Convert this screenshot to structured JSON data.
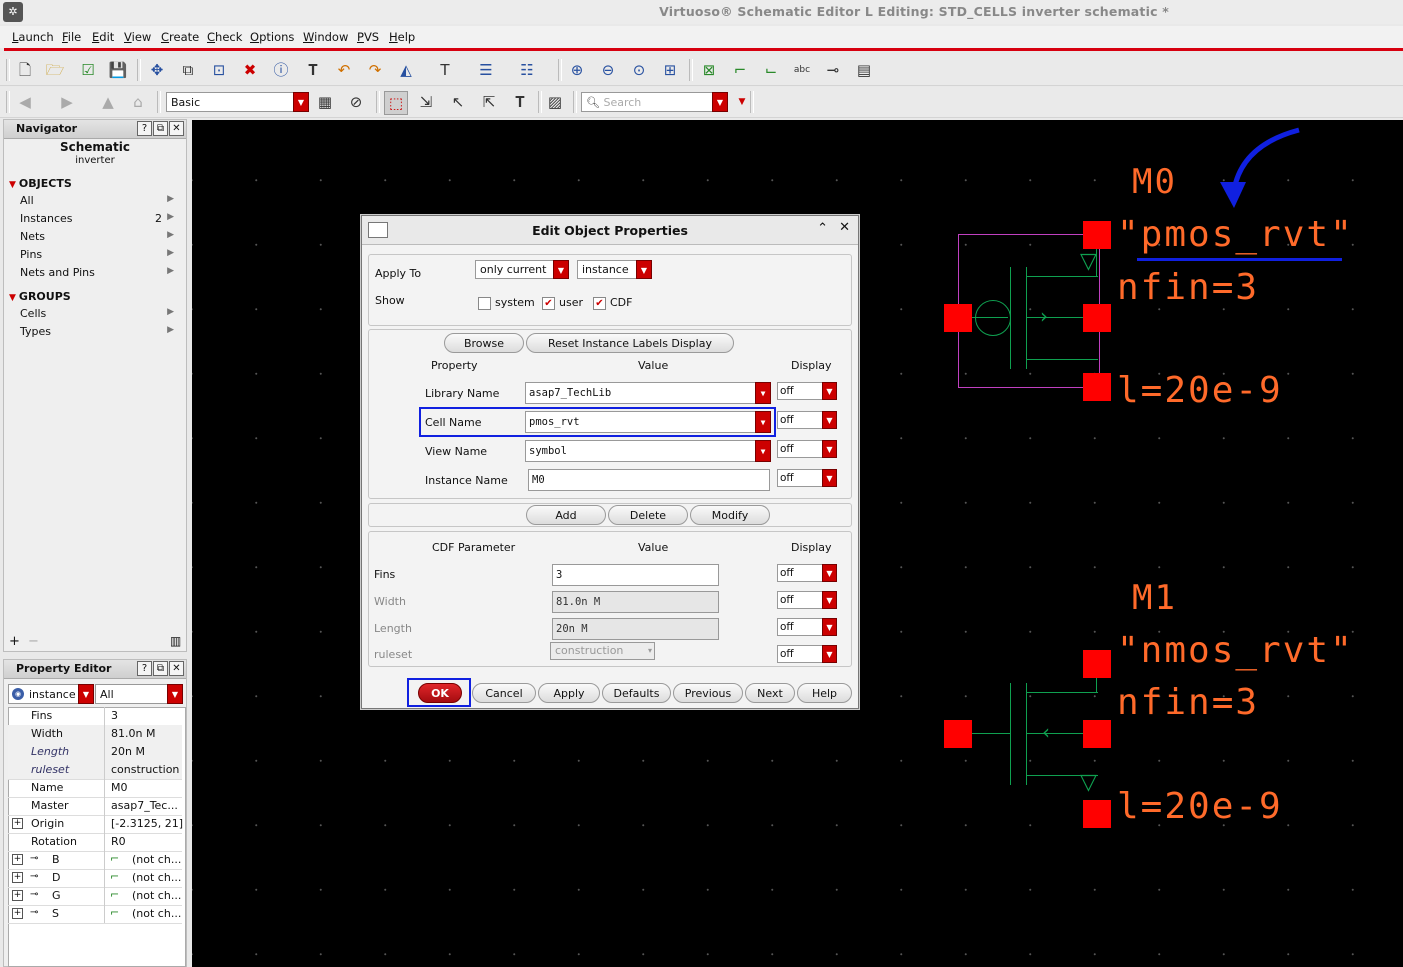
{
  "window": {
    "title": "Virtuoso® Schematic Editor L Editing: STD_CELLS inverter schematic *"
  },
  "menubar": {
    "items": [
      "Launch",
      "File",
      "Edit",
      "View",
      "Create",
      "Check",
      "Options",
      "Window",
      "PVS",
      "Help"
    ]
  },
  "toolbar2": {
    "mode_value": "Basic",
    "search_placeholder": "Search"
  },
  "navigator": {
    "title": "Navigator",
    "header_title": "Schematic",
    "header_sub": "inverter",
    "objects_label": "OBJECTS",
    "objects": [
      {
        "label": "All",
        "count": ""
      },
      {
        "label": "Instances",
        "count": "2"
      },
      {
        "label": "Nets",
        "count": ""
      },
      {
        "label": "Pins",
        "count": ""
      },
      {
        "label": "Nets and Pins",
        "count": ""
      }
    ],
    "groups_label": "GROUPS",
    "groups": [
      {
        "label": "Cells"
      },
      {
        "label": "Types"
      }
    ]
  },
  "property_editor": {
    "title": "Property Editor",
    "filter_type": "instance",
    "filter_scope": "All",
    "rows": [
      {
        "key": "Fins",
        "value": "3"
      },
      {
        "key": "Width",
        "value": "81.0n M"
      },
      {
        "key": "Length",
        "value": "20n M"
      },
      {
        "key": "ruleset",
        "value": "construction"
      },
      {
        "key": "Name",
        "value": "M0"
      },
      {
        "key": "Master",
        "value": "asap7_Tec..."
      },
      {
        "key": "Origin",
        "value": "[-2.3125, 21]"
      },
      {
        "key": "Rotation",
        "value": "R0"
      },
      {
        "key": "B",
        "value": "(not ch..."
      },
      {
        "key": "D",
        "value": "(not ch..."
      },
      {
        "key": "G",
        "value": "(not ch..."
      },
      {
        "key": "S",
        "value": "(not ch..."
      }
    ]
  },
  "dialog": {
    "title": "Edit Object Properties",
    "apply_to_label": "Apply To",
    "apply_to_value": "only current",
    "apply_to_type": "instance",
    "show_label": "Show",
    "show_options": [
      {
        "label": "system",
        "checked": false
      },
      {
        "label": "user",
        "checked": true
      },
      {
        "label": "CDF",
        "checked": true
      }
    ],
    "browse_label": "Browse",
    "reset_label": "Reset Instance Labels Display",
    "col_property": "Property",
    "col_value": "Value",
    "col_display": "Display",
    "properties": [
      {
        "label": "Library Name",
        "value": "asap7_TechLib",
        "display": "off"
      },
      {
        "label": "Cell Name",
        "value": "pmos_rvt",
        "display": "off"
      },
      {
        "label": "View Name",
        "value": "symbol",
        "display": "off"
      },
      {
        "label": "Instance Name",
        "value": "M0",
        "display": "off"
      }
    ],
    "add_label": "Add",
    "delete_label": "Delete",
    "modify_label": "Modify",
    "col_cdf": "CDF Parameter",
    "cdf": [
      {
        "label": "Fins",
        "value": "3",
        "display": "off"
      },
      {
        "label": "Width",
        "value": "81.0n M",
        "display": "off"
      },
      {
        "label": "Length",
        "value": "20n M",
        "display": "off"
      },
      {
        "label": "ruleset",
        "value": "construction",
        "display": "off"
      }
    ],
    "buttons": {
      "ok": "OK",
      "cancel": "Cancel",
      "apply": "Apply",
      "defaults": "Defaults",
      "previous": "Previous",
      "next": "Next",
      "help": "Help"
    }
  },
  "schematic": {
    "m0": {
      "name": "M0",
      "cell": "\"pmos_rvt\"",
      "nfin": "nfin=3",
      "l": "l=20e-9"
    },
    "m1": {
      "name": "M1",
      "cell": "\"nmos_rvt\"",
      "nfin": "nfin=3",
      "l": "l=20e-9"
    }
  },
  "colors": {
    "accent_red": "#d7000f",
    "highlight_blue": "#1020e0",
    "label_orange": "#ff6a2a",
    "wire_green": "#0fa050"
  }
}
